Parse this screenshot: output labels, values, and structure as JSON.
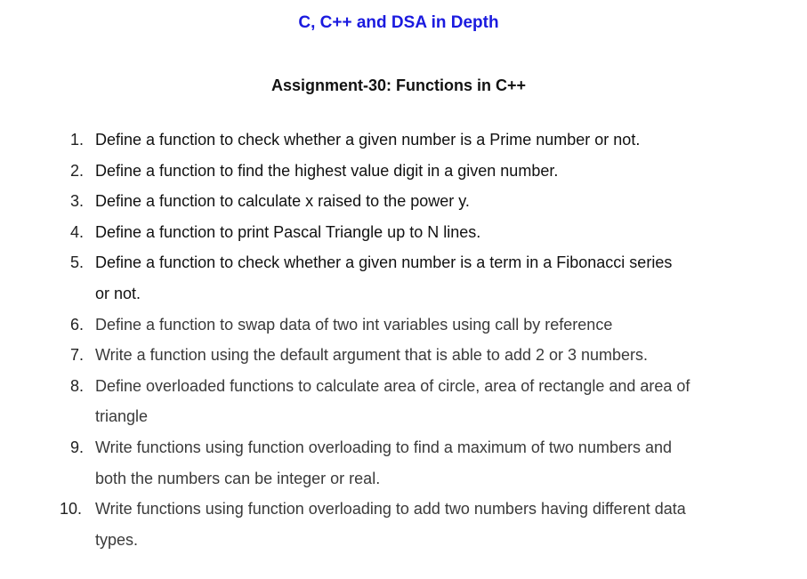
{
  "header": {
    "course_title": "C, C++ and DSA in Depth",
    "assignment_title": "Assignment-30: Functions in C++"
  },
  "tasks": [
    {
      "num": "1.",
      "text": "Define a function to check whether a given number is a Prime number or not."
    },
    {
      "num": "2.",
      "text": "Define a function to find the highest value digit in a given number."
    },
    {
      "num": "3.",
      "text": "Define a function to calculate x raised to the power y."
    },
    {
      "num": "4.",
      "text": "Define a function to print Pascal Triangle up to N lines."
    },
    {
      "num": "5.",
      "text": "Define a function to check whether a given number is a term in a Fibonacci series\nor not."
    },
    {
      "num": "6.",
      "text": "Define a function to swap data of two int variables using call by reference"
    },
    {
      "num": "7.",
      "text": "Write a function using the default argument that is able to add 2 or 3 numbers."
    },
    {
      "num": "8.",
      "text": "Define overloaded functions to calculate area of circle, area of rectangle and area of\ntriangle"
    },
    {
      "num": "9.",
      "text": "Write functions using function overloading to find a maximum of two numbers and\nboth the numbers can be integer or real."
    },
    {
      "num": "10.",
      "text": "Write functions using function overloading to add two numbers having different data\ntypes."
    }
  ],
  "colors": {
    "course_title": "#1a1adf",
    "text": "#222222"
  }
}
